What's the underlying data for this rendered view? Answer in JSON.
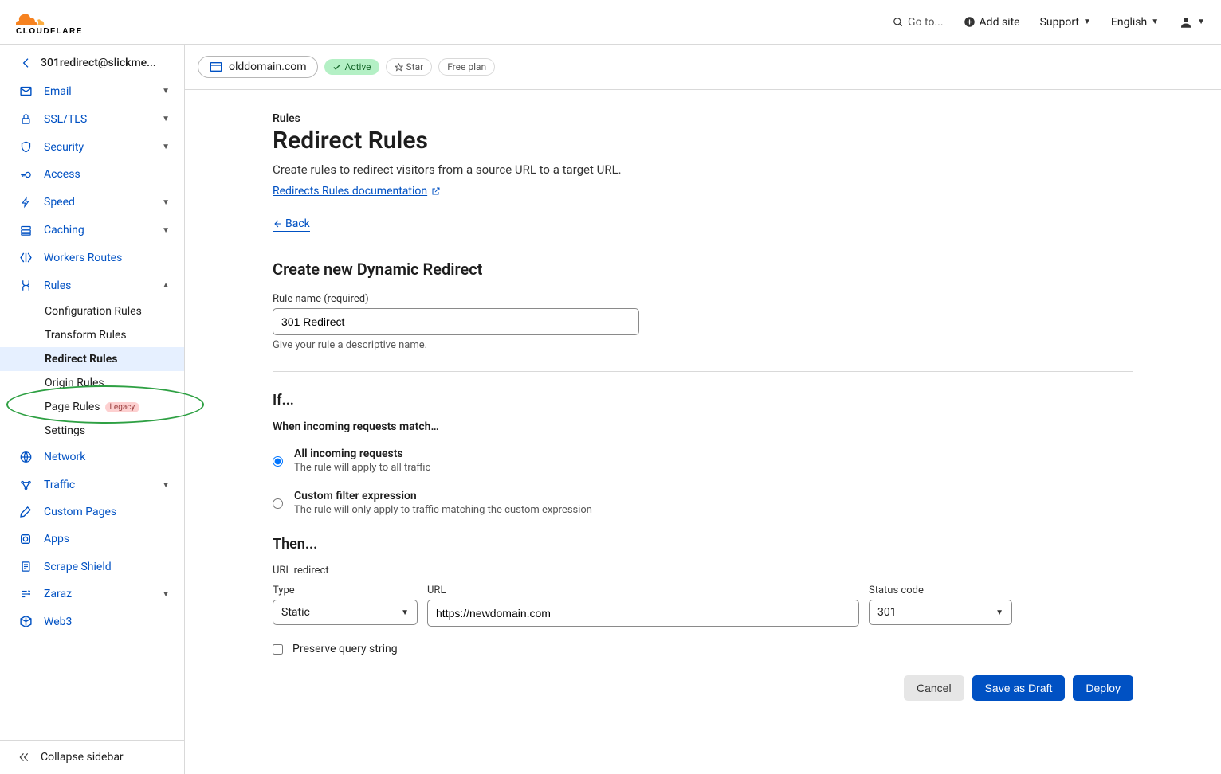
{
  "header": {
    "search_placeholder": "Go to...",
    "add_site": "Add site",
    "support": "Support",
    "language": "English"
  },
  "account": {
    "name": "301redirect@slickme..."
  },
  "sidebar": {
    "items": [
      {
        "label": "Email",
        "chev": true
      },
      {
        "label": "SSL/TLS",
        "chev": true
      },
      {
        "label": "Security",
        "chev": true
      },
      {
        "label": "Access",
        "chev": false
      },
      {
        "label": "Speed",
        "chev": true
      },
      {
        "label": "Caching",
        "chev": true
      },
      {
        "label": "Workers Routes",
        "chev": false
      },
      {
        "label": "Rules",
        "chev": true,
        "expanded": true
      },
      {
        "label": "Network",
        "chev": false
      },
      {
        "label": "Traffic",
        "chev": true
      },
      {
        "label": "Custom Pages",
        "chev": false
      },
      {
        "label": "Apps",
        "chev": false
      },
      {
        "label": "Scrape Shield",
        "chev": false
      },
      {
        "label": "Zaraz",
        "chev": true
      },
      {
        "label": "Web3",
        "chev": false
      }
    ],
    "rules_sub": [
      {
        "label": "Configuration Rules"
      },
      {
        "label": "Transform Rules"
      },
      {
        "label": "Redirect Rules",
        "active": true
      },
      {
        "label": "Origin Rules"
      },
      {
        "label": "Page Rules",
        "legacy": "Legacy"
      },
      {
        "label": "Settings"
      }
    ],
    "collapse": "Collapse sidebar"
  },
  "domain": {
    "name": "olddomain.com",
    "status": "Active",
    "star": "Star",
    "plan": "Free plan"
  },
  "page": {
    "breadcrumb": "Rules",
    "title": "Redirect Rules",
    "desc": "Create rules to redirect visitors from a source URL to a target URL.",
    "doc_link": "Redirects Rules documentation",
    "back": "Back",
    "section_title": "Create new Dynamic Redirect",
    "rule_name_label": "Rule name (required)",
    "rule_name_value": "301 Redirect",
    "rule_name_hint": "Give your rule a descriptive name.",
    "if_title": "If...",
    "if_subhead": "When incoming requests match…",
    "radio1_label": "All incoming requests",
    "radio1_desc": "The rule will apply to all traffic",
    "radio2_label": "Custom filter expression",
    "radio2_desc": "The rule will only apply to traffic matching the custom expression",
    "then_title": "Then...",
    "url_redirect": "URL redirect",
    "type_label": "Type",
    "type_value": "Static",
    "url_label": "URL",
    "url_value": "https://newdomain.com",
    "code_label": "Status code",
    "code_value": "301",
    "preserve_qs": "Preserve query string",
    "btn_cancel": "Cancel",
    "btn_draft": "Save as Draft",
    "btn_deploy": "Deploy"
  }
}
